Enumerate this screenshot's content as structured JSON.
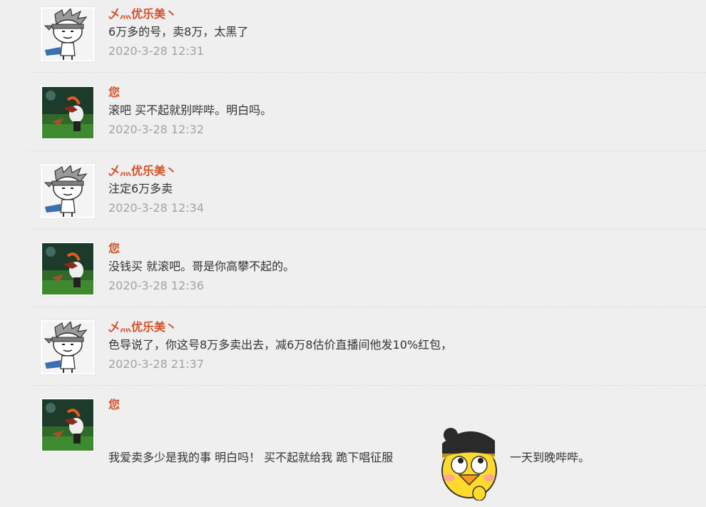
{
  "messages": [
    {
      "sender": "乄灬优乐美丶",
      "text": "6万多的号，卖8万，太黑了",
      "time": "2020-3-28 12:31",
      "avatar": "cartoon-avatar"
    },
    {
      "sender": "您",
      "text": "滚吧 买不起就别哔哔。明白吗。",
      "time": "2020-3-28 12:32",
      "avatar": "photo-avatar"
    },
    {
      "sender": "乄灬优乐美丶",
      "text": "注定6万多卖",
      "time": "2020-3-28 12:34",
      "avatar": "cartoon-avatar"
    },
    {
      "sender": "您",
      "text": "没钱买 就滚吧。哥是你高攀不起的。",
      "time": "2020-3-28 12:36",
      "avatar": "photo-avatar"
    },
    {
      "sender": "乄灬优乐美丶",
      "text": "色导说了，你这号8万多卖出去，减6万8估价直播间他发10%红包，",
      "time": "2020-3-28 21:37",
      "avatar": "cartoon-avatar"
    },
    {
      "sender": "您",
      "text_before_sticker": "我爱卖多少是我的事 明白吗！ 买不起就给我 跪下唱征服",
      "sticker": "yellow-duck-sticker",
      "text_after_sticker": "一天到晚哔哔。",
      "avatar": "photo-avatar"
    }
  ],
  "colors": {
    "name": "#d2522a",
    "text": "#333333",
    "time": "#a2a2a2",
    "background": "#efefef"
  }
}
